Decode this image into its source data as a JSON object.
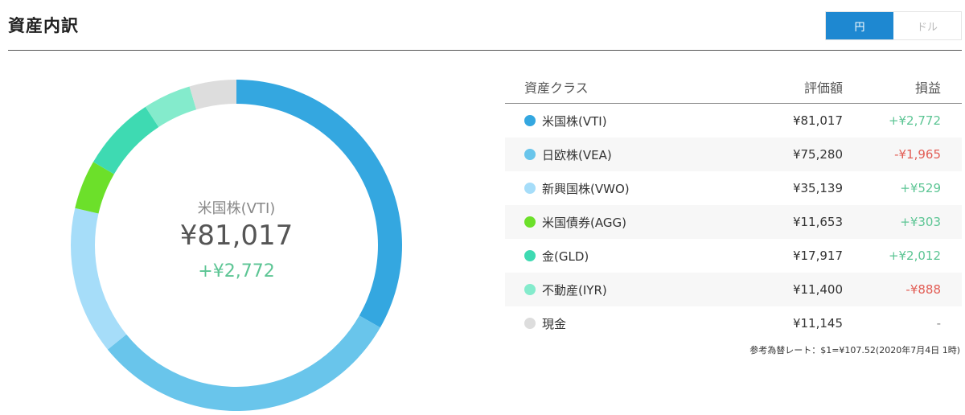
{
  "header": {
    "title": "資産内訳",
    "currency_yen": "円",
    "currency_dollar": "ドル"
  },
  "center": {
    "label": "米国株(VTI)",
    "value": "¥81,017",
    "delta": "+¥2,772"
  },
  "table": {
    "headers": [
      "資産クラス",
      "評価額",
      "損益"
    ],
    "rows": [
      {
        "name": "米国株(VTI)",
        "value": "¥81,017",
        "pl": "+¥2,772",
        "color": "#34a7e0",
        "pl_color": "#5cc594"
      },
      {
        "name": "日欧株(VEA)",
        "value": "¥75,280",
        "pl": "-¥1,965",
        "color": "#69c5eb",
        "pl_color": "#e25d55"
      },
      {
        "name": "新興国株(VWO)",
        "value": "¥35,139",
        "pl": "+¥529",
        "color": "#a6ddf9",
        "pl_color": "#5cc594"
      },
      {
        "name": "米国債券(AGG)",
        "value": "¥11,653",
        "pl": "+¥303",
        "color": "#6ce02a",
        "pl_color": "#5cc594"
      },
      {
        "name": "金(GLD)",
        "value": "¥17,917",
        "pl": "+¥2,012",
        "color": "#3edab2",
        "pl_color": "#5cc594"
      },
      {
        "name": "不動産(IYR)",
        "value": "¥11,400",
        "pl": "-¥888",
        "color": "#84ebcc",
        "pl_color": "#e25d55"
      },
      {
        "name": "現金",
        "value": "¥11,145",
        "pl": "-",
        "color": "#dddddd",
        "pl_color": "#888888"
      }
    ]
  },
  "note": "参考為替レート：$1=¥107.52(2020年7月4日 1時)",
  "chart_data": {
    "type": "pie",
    "categories": [
      "米国株(VTI)",
      "日欧株(VEA)",
      "新興国株(VWO)",
      "米国債券(AGG)",
      "金(GLD)",
      "不動産(IYR)",
      "現金"
    ],
    "values": [
      81017,
      75280,
      35139,
      11653,
      17917,
      11400,
      11145
    ],
    "colors": [
      "#34a7e0",
      "#69c5eb",
      "#a6ddf9",
      "#6ce02a",
      "#3edab2",
      "#84ebcc",
      "#dddddd"
    ]
  }
}
